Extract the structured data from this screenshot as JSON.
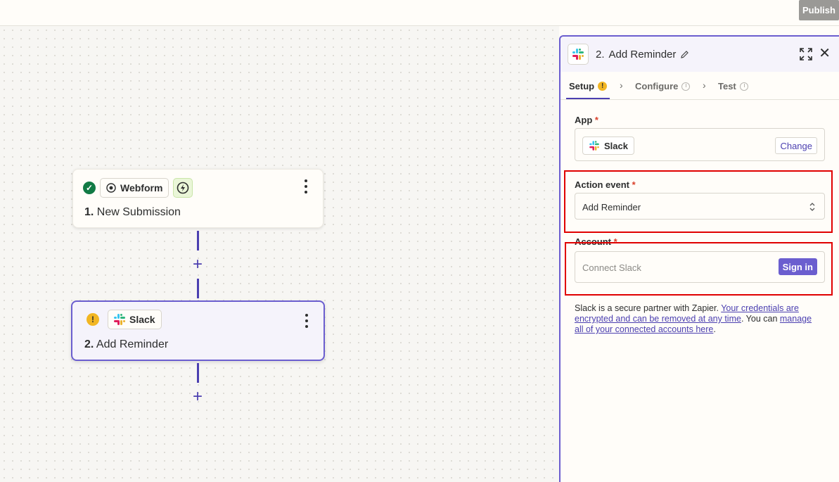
{
  "topbar": {
    "publish_label": "Publish"
  },
  "canvas": {
    "steps": [
      {
        "status": "success",
        "app_label": "Webform",
        "number": "1.",
        "title": "New Submission",
        "trigger": true
      },
      {
        "status": "warning",
        "app_label": "Slack",
        "number": "2.",
        "title": "Add Reminder",
        "trigger": false
      }
    ],
    "add_step_symbol": "+"
  },
  "panel": {
    "step_number": "2.",
    "title": "Add Reminder",
    "close_symbol": "✕",
    "tabs": [
      {
        "label": "Setup",
        "state": "warning"
      },
      {
        "label": "Configure",
        "state": "pending"
      },
      {
        "label": "Test",
        "state": "pending"
      }
    ],
    "tab_separator": "›",
    "app_field": {
      "label": "App",
      "required": "*",
      "value": "Slack",
      "change_label": "Change"
    },
    "action_event_field": {
      "label": "Action event",
      "required": "*",
      "value": "Add Reminder"
    },
    "account_field": {
      "label": "Account",
      "required": "*",
      "placeholder": "Connect Slack",
      "signin_label": "Sign in"
    },
    "info": {
      "prefix": "Slack is a secure partner with Zapier. ",
      "link1": "Your credentials are encrypted and can be removed at any time",
      "middle": ". You can ",
      "link2": "manage all of your connected accounts here",
      "suffix": "."
    }
  },
  "colors": {
    "accent": "#6b5ecf",
    "connector": "#4b3fb0",
    "success": "#117a45",
    "warning": "#f2b623",
    "highlight_box": "#e00000"
  },
  "icons": [
    "check-icon",
    "webform-icon",
    "lightning-icon",
    "kebab-menu-icon",
    "warning-icon",
    "slack-icon",
    "pencil-icon",
    "expand-icon",
    "close-icon",
    "chevron-right-icon",
    "clock-icon",
    "chevron-updown-icon",
    "plus-icon"
  ]
}
